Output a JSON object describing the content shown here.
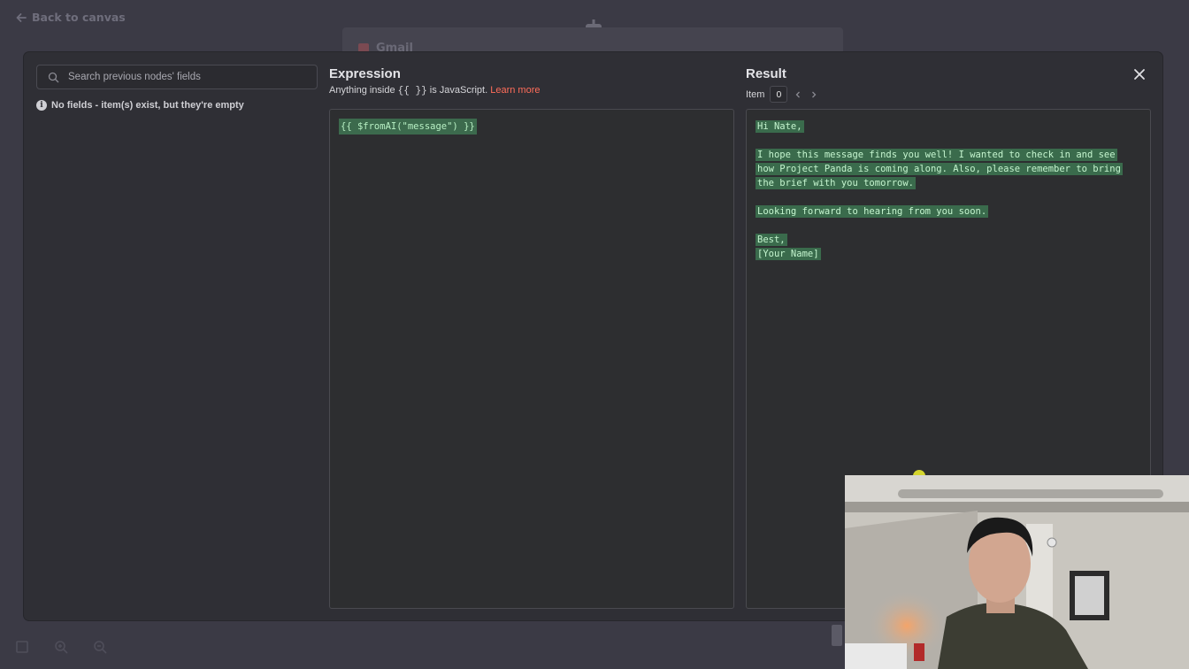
{
  "topbar": {
    "back_label": "Back to canvas",
    "node_title": "Gmail"
  },
  "search": {
    "placeholder": "Search previous nodes' fields"
  },
  "inputs_panel": {
    "empty_message": "No fields - item(s) exist, but they're empty"
  },
  "expression": {
    "title": "Expression",
    "hint_prefix": "Anything inside",
    "hint_braces": "{{ }}",
    "hint_suffix": "is JavaScript.",
    "learn_more": "Learn more",
    "code": "{{ $fromAI(\"message\") }}"
  },
  "result": {
    "title": "Result",
    "item_label": "Item",
    "item_index": "0",
    "lines": [
      "Hi Nate,",
      "",
      "I hope this message finds you well! I wanted to check in and see",
      "how Project Panda is coming along. Also, please remember to bring",
      "the brief with you tomorrow.",
      "",
      "Looking forward to hearing from you soon.",
      "",
      "Best,",
      "[Your Name]"
    ]
  },
  "colors": {
    "accent_link": "#ff6d5a",
    "code_highlight_bg": "#3a6b4c",
    "code_text": "#c5f5cf",
    "modal_bg": "#2f2f35"
  },
  "icons": [
    "arrow-left-icon",
    "robot-icon",
    "search-icon",
    "info-icon",
    "chevron-left-icon",
    "chevron-right-icon",
    "close-icon",
    "zoom-in-icon",
    "zoom-out-icon",
    "fit-view-icon"
  ]
}
